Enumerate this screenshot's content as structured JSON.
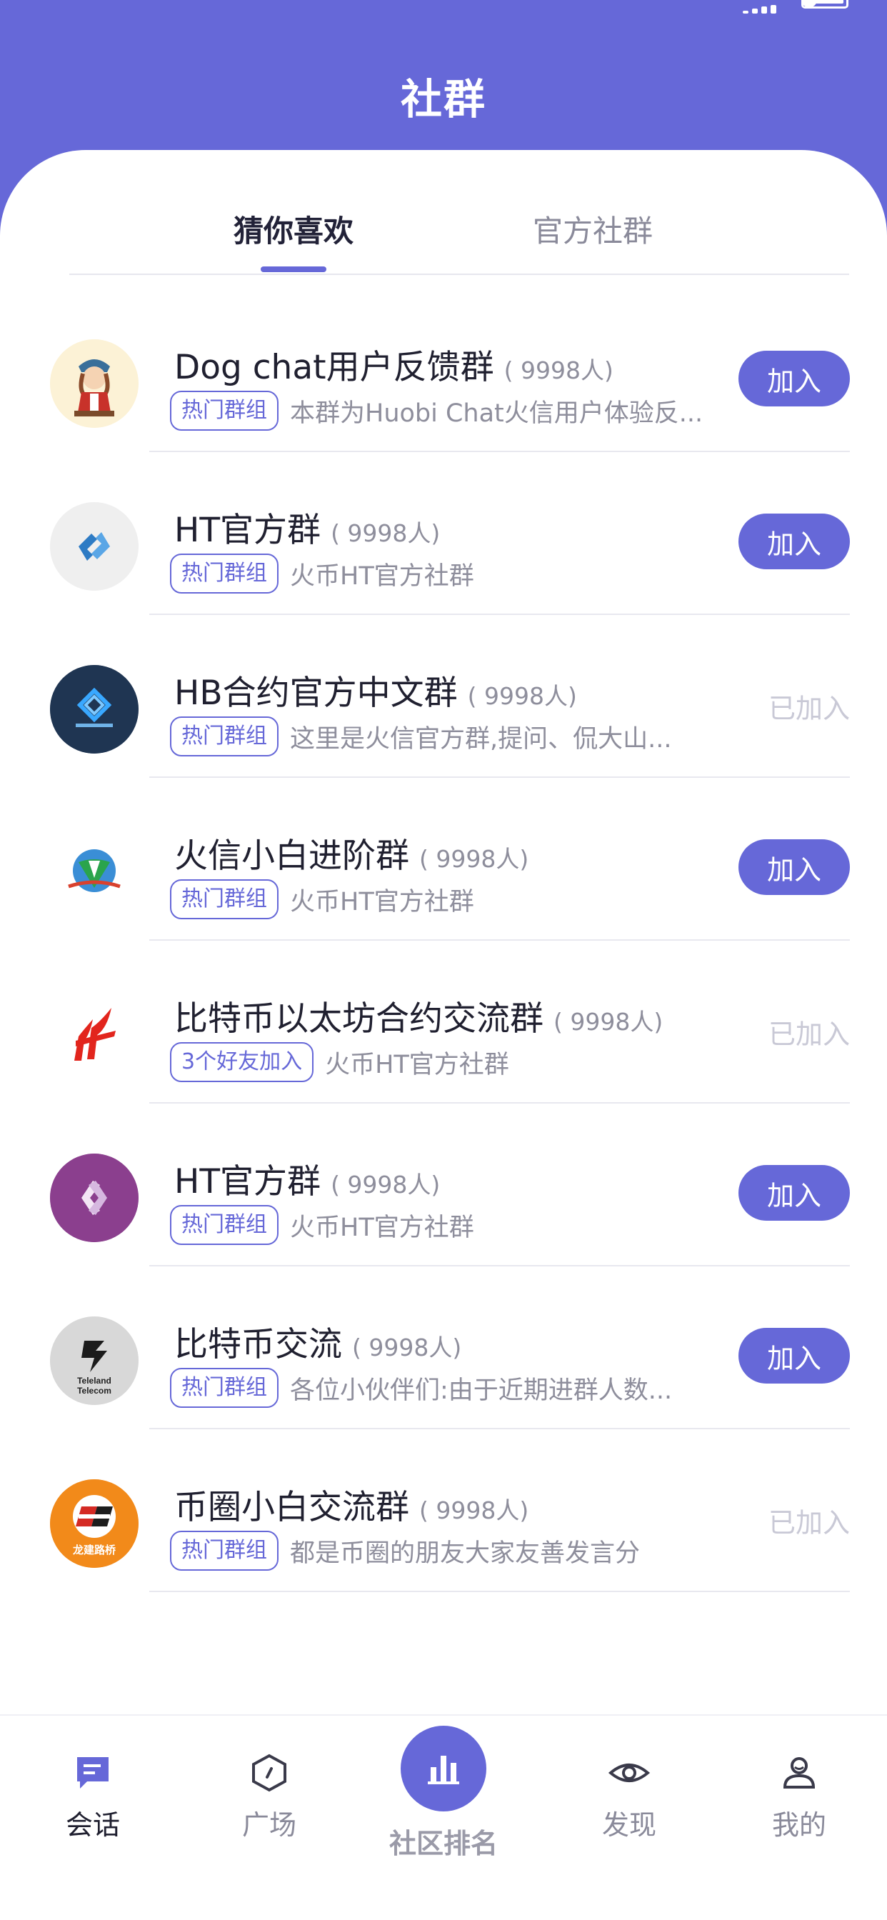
{
  "header": {
    "title": "社群"
  },
  "tabs": [
    {
      "label": "猜你喜欢",
      "active": true
    },
    {
      "label": "官方社群",
      "active": false
    }
  ],
  "groups": [
    {
      "name": "Dog chat用户反馈群",
      "count": "( 9998人)",
      "tag": "热门群组",
      "desc": "本群为Huobi Chat火信用户体验反...",
      "action": "加入",
      "joined": false,
      "avatar": "cartoon-girl"
    },
    {
      "name": "HT官方群",
      "count": "( 9998人)",
      "tag": "热门群组",
      "desc": "火币HT官方社群",
      "action": "加入",
      "joined": false,
      "avatar": "blue-link"
    },
    {
      "name": "HB合约官方中文群",
      "count": "( 9998人)",
      "tag": "热门群组",
      "desc": "这里是火信官方群,提问、侃大山...",
      "action": "已加入",
      "joined": true,
      "avatar": "lorem-dark"
    },
    {
      "name": "火信小白进阶群",
      "count": "( 9998人)",
      "tag": "热门群组",
      "desc": "火币HT官方社群",
      "action": "加入",
      "joined": false,
      "avatar": "globe-green"
    },
    {
      "name": "比特币以太坊合约交流群",
      "count": "( 9998人)",
      "tag": "3个好友加入",
      "desc": "火币HT官方社群",
      "action": "已加入",
      "joined": true,
      "avatar": "red-flame"
    },
    {
      "name": "HT官方群",
      "count": "( 9998人)",
      "tag": "热门群组",
      "desc": "火币HT官方社群",
      "action": "加入",
      "joined": false,
      "avatar": "purple-hex"
    },
    {
      "name": "比特币交流",
      "count": "( 9998人)",
      "tag": "热门群组",
      "desc": "各位小伙伴们:由于近期进群人数...",
      "action": "加入",
      "joined": false,
      "avatar": "teleland",
      "avatar_text": "Teleland Telecom"
    },
    {
      "name": "币圈小白交流群",
      "count": "( 9998人)",
      "tag": "热门群组",
      "desc": "都是币圈的朋友大家友善发言分",
      "action": "已加入",
      "joined": true,
      "avatar": "orange-road",
      "avatar_text": "龙建路桥"
    }
  ],
  "nav": [
    {
      "label": "会话",
      "icon": "chat-icon",
      "active": true
    },
    {
      "label": "广场",
      "icon": "hexagon-icon",
      "active": false
    },
    {
      "label": "社区排名",
      "icon": "bar-chart-icon",
      "active": false
    },
    {
      "label": "发现",
      "icon": "eye-icon",
      "active": false
    },
    {
      "label": "我的",
      "icon": "user-icon",
      "active": false
    }
  ],
  "colors": {
    "accent": "#6668d8",
    "joined_text": "#c9c9d6"
  }
}
